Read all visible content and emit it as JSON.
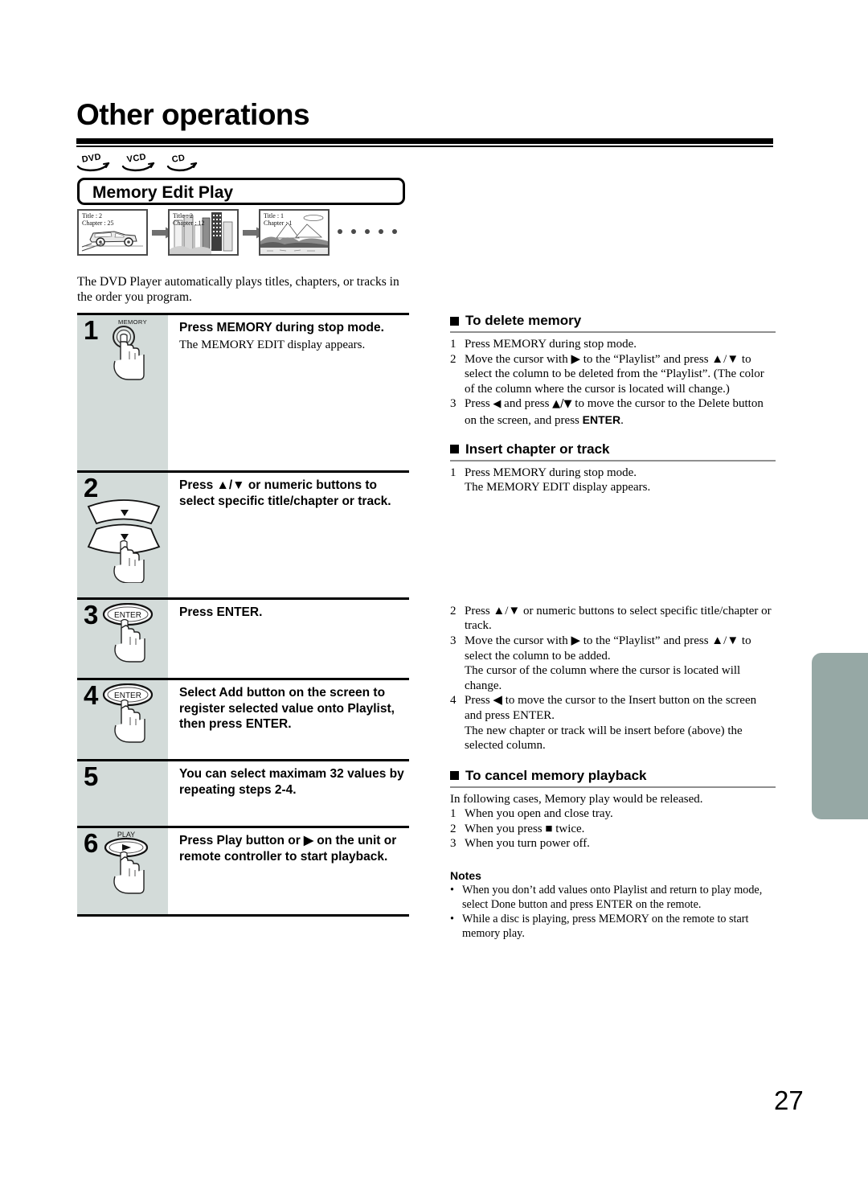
{
  "page": {
    "title": "Other operations",
    "number": "27"
  },
  "badges": [
    {
      "label": "DVD",
      "name": "dvd-badge"
    },
    {
      "label": "VCD",
      "name": "vcd-badge"
    },
    {
      "label": "CD",
      "name": "cd-badge"
    }
  ],
  "section": {
    "heading": "Memory Edit Play",
    "intro": "The DVD Player automatically plays titles, chapters, or tracks in the order you program."
  },
  "thumbnails": [
    {
      "title": "Title : 2",
      "chapter": "Chapter : 25",
      "scene": "car"
    },
    {
      "title": "Title : 2",
      "chapter": "Chapter : 12",
      "scene": "buildings"
    },
    {
      "title": "Title : 1",
      "chapter": "Chapter : 1",
      "scene": "mountains"
    }
  ],
  "thumb_dots_count": 5,
  "steps": [
    {
      "num": "1",
      "icon": "memory-button",
      "icon_label": "MEMORY",
      "head": "Press MEMORY during stop mode.",
      "sub": "The MEMORY EDIT display appears."
    },
    {
      "num": "2",
      "icon": "up-down-cursor-buttons",
      "icon_label": "",
      "head": "Press ▲/▼ or numeric buttons to select specific title/chapter or track.",
      "sub": ""
    },
    {
      "num": "3",
      "icon": "enter-button",
      "icon_label": "ENTER",
      "head": "Press ENTER.",
      "sub": ""
    },
    {
      "num": "4",
      "icon": "enter-button",
      "icon_label": "ENTER",
      "head": "Select Add button on the screen to register selected value onto Playlist, then press ENTER.",
      "sub": ""
    },
    {
      "num": "5",
      "icon": "none",
      "icon_label": "",
      "head": "You can select maximam 32 values by repeating steps 2-4.",
      "sub": ""
    },
    {
      "num": "6",
      "icon": "play-button",
      "icon_label": "PLAY",
      "head": "Press Play button or ▶ on the unit or remote controller to start playback.",
      "sub": ""
    }
  ],
  "right_sections": [
    {
      "heading": "To delete memory",
      "items": [
        {
          "mark": "1",
          "text": "Press MEMORY during stop mode."
        },
        {
          "mark": "2",
          "text": "Move the cursor with ▶ to the “Playlist” and press ▲/▼ to select the column to be deleted from the “Playlist”. (The color of the column where the cursor is located will change.)"
        },
        {
          "mark": "3",
          "text": "Press ◀ and press ▲/▼ to move the cursor to the Delete button on the screen, and press ENTER."
        }
      ]
    },
    {
      "heading": "Insert chapter or track",
      "items": [
        {
          "mark": "1",
          "text": "Press MEMORY during stop mode.\nThe MEMORY EDIT display appears."
        },
        {
          "mark": "2",
          "text": "Press ▲/▼ or numeric buttons to select specific title/chapter or track."
        },
        {
          "mark": "3",
          "text": "Move the cursor with ▶ to the “Playlist” and press ▲/▼ to select the column to be added.\nThe cursor of the column where the cursor is located will change."
        },
        {
          "mark": "4",
          "text": "Press ◀ to move the cursor to the Insert button on the screen and press ENTER.\nThe new chapter or track will be insert before (above) the selected column."
        }
      ]
    },
    {
      "heading": "To cancel memory playback",
      "lead": "In following cases, Memory play would be released.",
      "items": [
        {
          "mark": "1",
          "text": "When you open and close tray."
        },
        {
          "mark": "2",
          "text": "When you press ■ twice."
        },
        {
          "mark": "3",
          "text": "When you turn power off."
        }
      ]
    }
  ],
  "notes": {
    "title": "Notes",
    "items": [
      "When you don’t add values onto Playlist and return to play mode, select Done button and press ENTER on the remote.",
      "While a disc is playing, press MEMORY on the remote to start memory play."
    ]
  },
  "colors": {
    "step_column": "#d3dbd9",
    "side_tab": "#96a8a5",
    "rule": "#000000",
    "section_rule": "#8f8f8f"
  }
}
